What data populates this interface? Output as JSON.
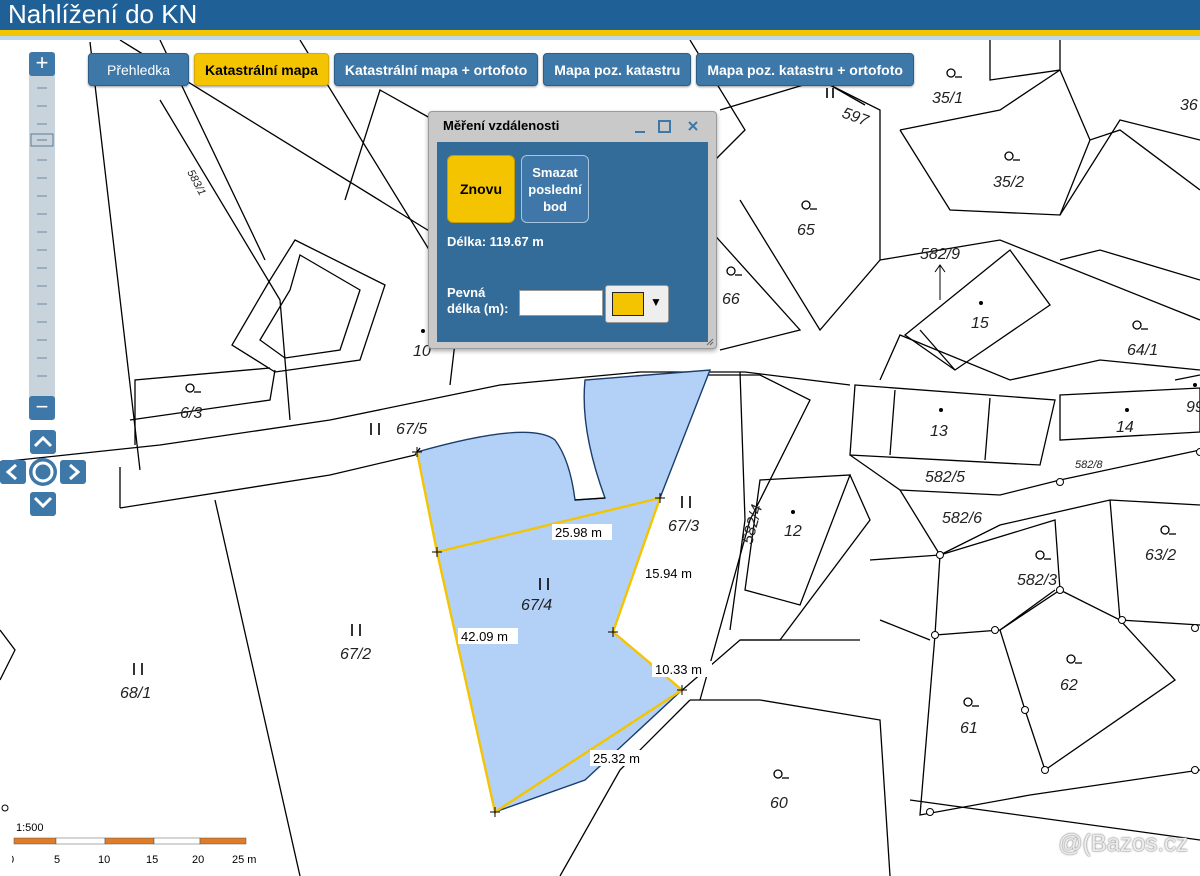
{
  "header": {
    "title": "Nahlížení do KN"
  },
  "tabs": [
    {
      "label": "Přehledka",
      "active": false
    },
    {
      "label": "Katastrální mapa",
      "active": true
    },
    {
      "label": "Katastrální mapa + ortofoto",
      "active": false
    },
    {
      "label": "Mapa poz. katastru",
      "active": false
    },
    {
      "label": "Mapa poz. katastru + ortofoto",
      "active": false
    }
  ],
  "zoom": {
    "plus": "+",
    "minus": "−"
  },
  "dialog": {
    "title": "Měření vzdálenosti",
    "btn_again": "Znovu",
    "btn_delete_last": "Smazat poslední bod",
    "total_length": "Délka: 119.67 m",
    "fixed_length_label": "Pevná délka (m):",
    "fixed_length_value": "",
    "line_color": "#f5c400"
  },
  "parcels": {
    "p35_1": "35/1",
    "p36": "36",
    "p597": "597",
    "p583_1": "583/1",
    "p35_2": "35/2",
    "p65": "65",
    "p582_9": "582/9",
    "p66": "66",
    "p15": "15",
    "p64_1": "64/1",
    "p10": "10",
    "p6_3": "6/3",
    "p67_5": "67/5",
    "p13": "13",
    "p14": "14",
    "p99": "99",
    "p582_8": "582/8",
    "p582_5": "582/5",
    "p67_3": "67/3",
    "p582_4": "582/4",
    "p12": "12",
    "p582_6": "582/6",
    "p582_3": "582/3",
    "p63_2": "63/2",
    "p67_4": "67/4",
    "p67_2": "67/2",
    "p68_1": "68/1",
    "p61": "61",
    "p62": "62",
    "p60": "60"
  },
  "measurements": {
    "m1": "25.98 m",
    "m2": "15.94 m",
    "m3": "42.09 m",
    "m4": "10.33 m",
    "m5": "25.32 m"
  },
  "highlight_color": "#b3d1f7",
  "scale": {
    "ratio": "1:500",
    "ticks": [
      "0",
      "5",
      "10",
      "15",
      "20",
      "25 m"
    ]
  },
  "watermark": "Bazos.cz"
}
